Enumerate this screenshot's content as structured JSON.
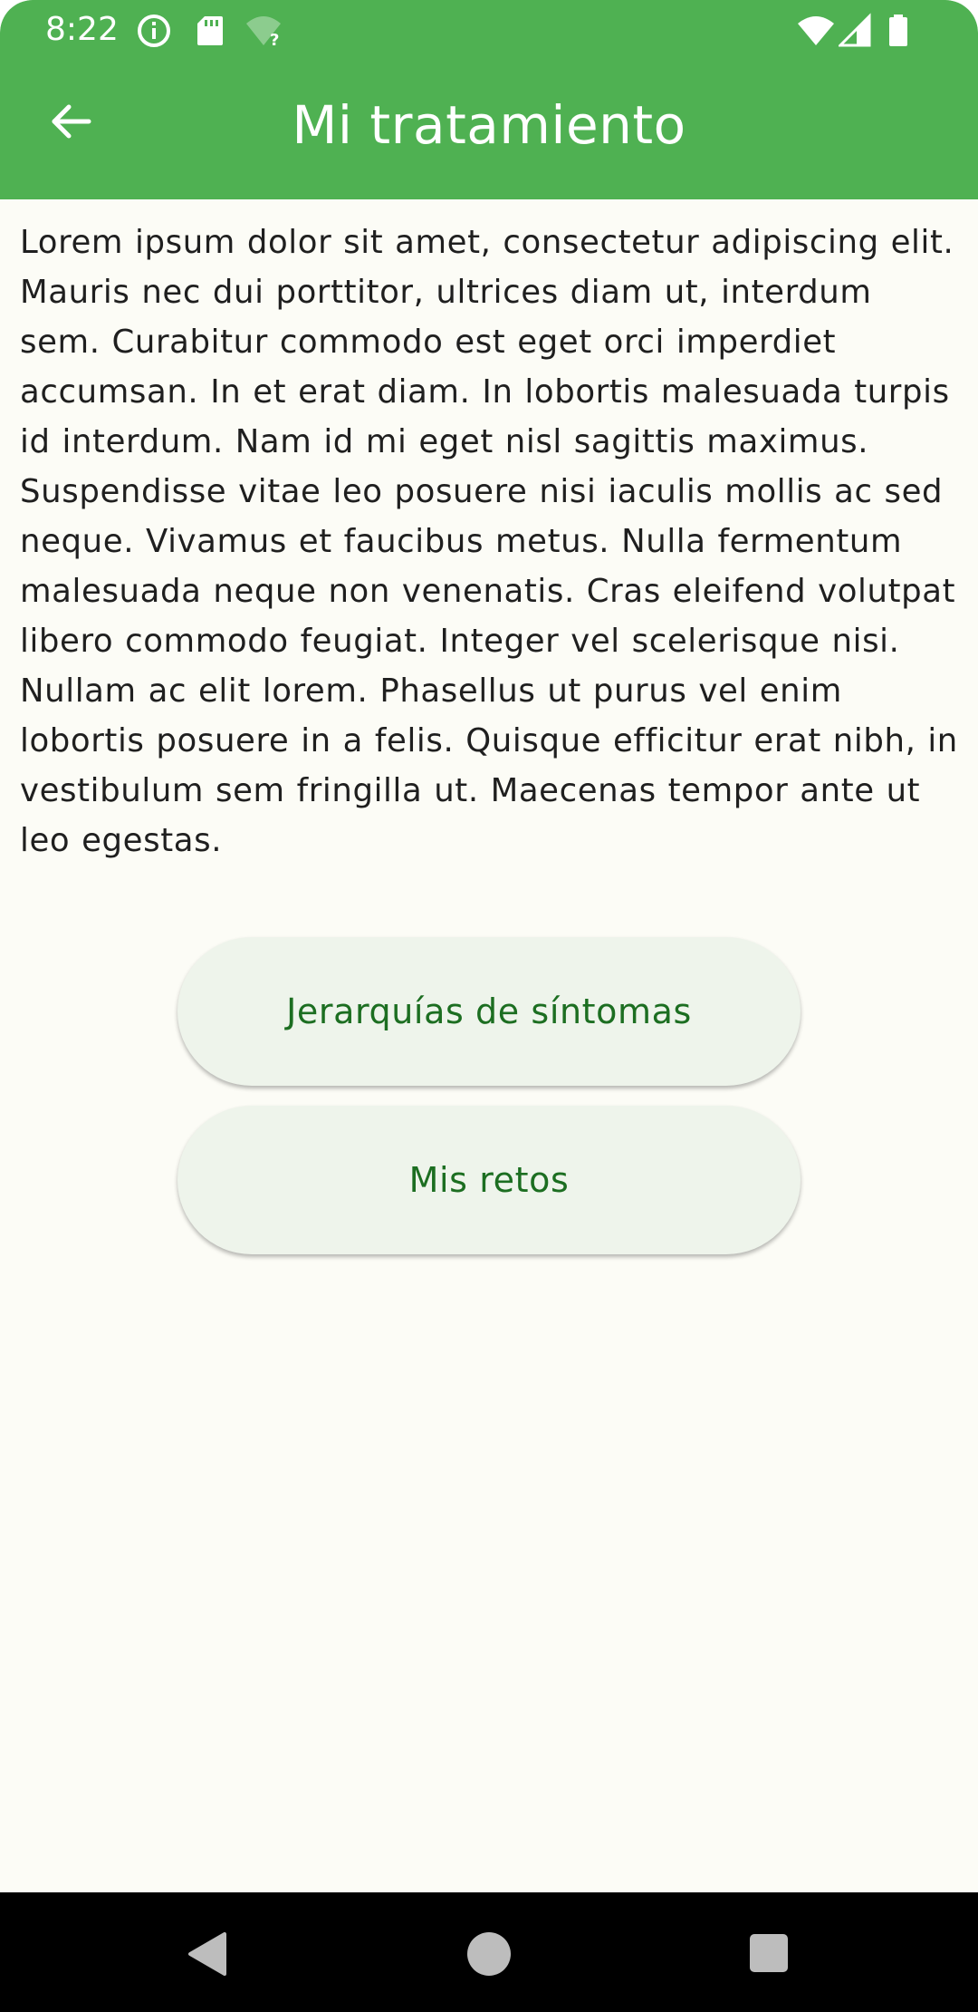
{
  "status_bar": {
    "time": "8:22",
    "icons": [
      "info-icon",
      "sd-card-icon",
      "wifi-question-icon",
      "wifi-icon",
      "signal-icon",
      "battery-icon"
    ]
  },
  "app_bar": {
    "title": "Mi tratamiento",
    "back_icon": "arrow-back-icon"
  },
  "main": {
    "description": "Lorem ipsum dolor sit amet, consectetur adipiscing elit. Mauris nec dui porttitor, ultrices diam ut, interdum sem. Curabitur commodo est eget orci imperdiet accumsan. In et erat diam. In lobortis malesuada turpis id interdum. Nam id mi eget nisl sagittis maximus. Suspendisse vitae leo posuere nisi iaculis mollis ac sed neque. Vivamus et faucibus metus. Nulla fermentum malesuada neque non venenatis. Cras eleifend volutpat libero commodo feugiat. Integer vel scelerisque nisi. Nullam ac elit lorem. Phasellus ut purus vel enim lobortis posuere in a felis. Quisque efficitur erat nibh, in vestibulum sem fringilla ut. Maecenas tempor ante ut leo egestas.",
    "buttons": [
      {
        "label": "Jerarquías de síntomas"
      },
      {
        "label": "Mis retos"
      }
    ]
  },
  "nav_bar": {
    "icons": [
      "nav-back-icon",
      "nav-home-icon",
      "nav-recents-icon"
    ]
  },
  "colors": {
    "primary": "#4FB152",
    "background": "#FCFCF6",
    "button_bg": "#EEF4EB",
    "button_text": "#1C6E21"
  }
}
